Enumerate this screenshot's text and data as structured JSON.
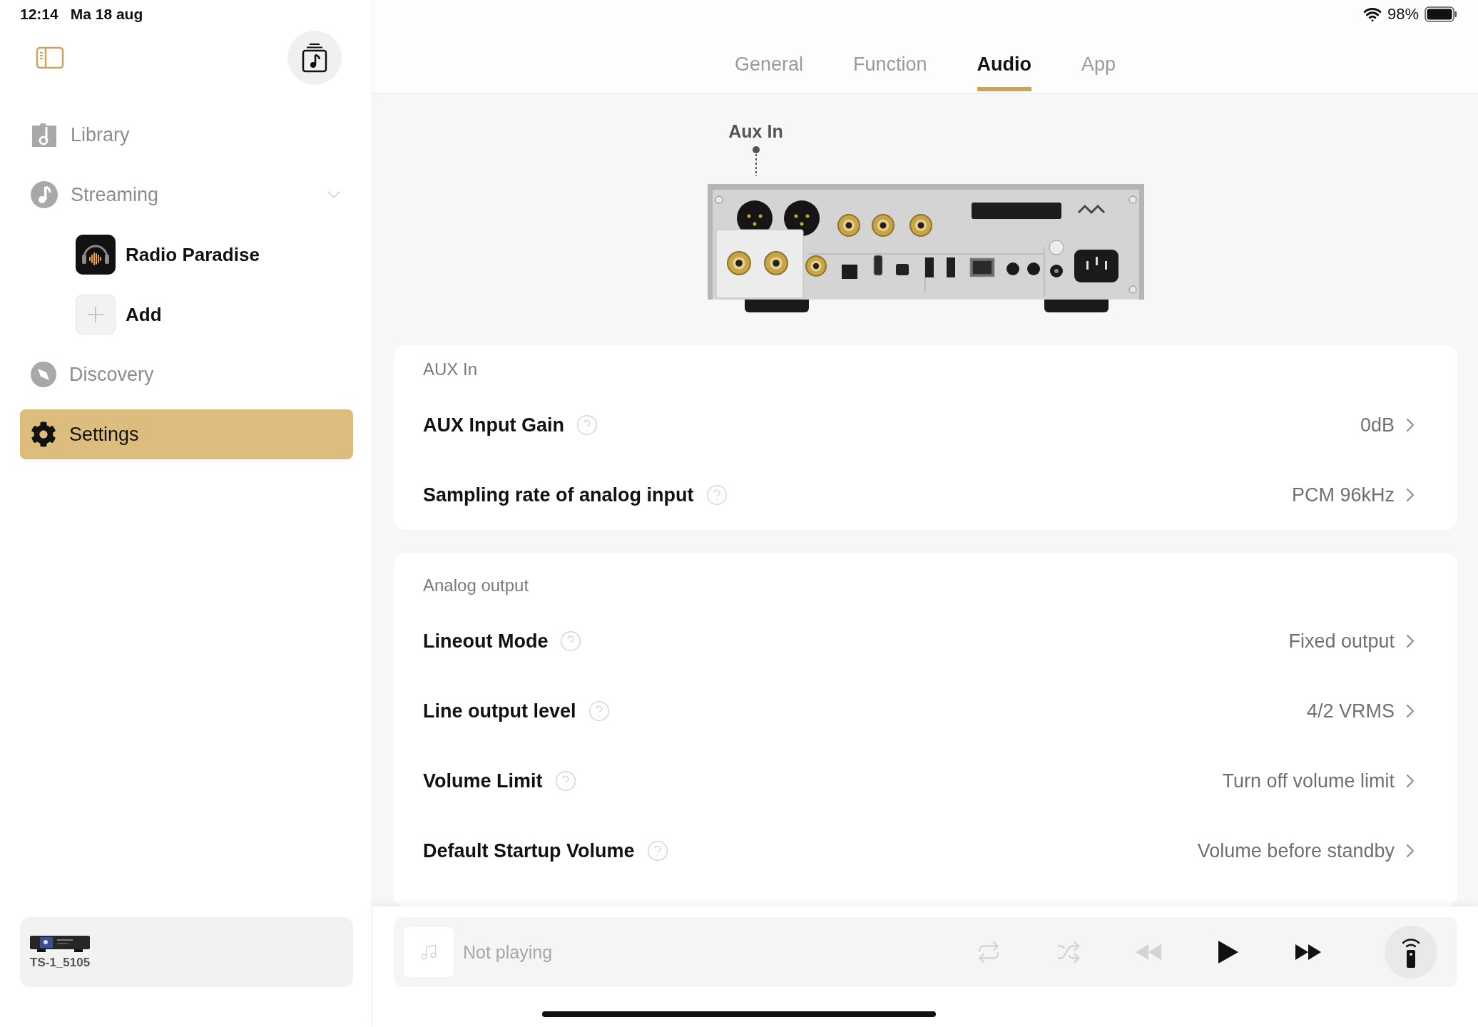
{
  "status_bar": {
    "time": "12:14",
    "date": "Ma 18 aug",
    "battery": "98%"
  },
  "sidebar": {
    "items": [
      {
        "label": "Library",
        "selected": false
      },
      {
        "label": "Streaming",
        "selected": false,
        "expanded": true,
        "children": [
          {
            "kind": "station",
            "label": "Radio Paradise"
          },
          {
            "kind": "add",
            "label": "Add"
          }
        ]
      },
      {
        "label": "Discovery",
        "selected": false
      },
      {
        "label": "Settings",
        "selected": true
      }
    ],
    "device": {
      "name": "TS-1_5105"
    }
  },
  "tabs": [
    {
      "label": "General",
      "selected": false
    },
    {
      "label": "Function",
      "selected": false
    },
    {
      "label": "Audio",
      "selected": true
    },
    {
      "label": "App",
      "selected": false
    }
  ],
  "diagram": {
    "callout": "Aux In"
  },
  "sections": [
    {
      "title": "AUX In",
      "rows": [
        {
          "label": "AUX Input Gain",
          "value": "0dB"
        },
        {
          "label": "Sampling rate of analog input",
          "value": "PCM 96kHz"
        }
      ]
    },
    {
      "title": "Analog output",
      "rows": [
        {
          "label": "Lineout Mode",
          "value": "Fixed output"
        },
        {
          "label": "Line output level",
          "value": "4/2 VRMS"
        },
        {
          "label": "Volume Limit",
          "value": "Turn off volume limit"
        },
        {
          "label": "Default Startup Volume",
          "value": "Volume before standby"
        }
      ]
    }
  ],
  "player": {
    "status": "Not playing",
    "controls": [
      {
        "kind": "repeat",
        "disabled": true
      },
      {
        "kind": "shuffle",
        "disabled": true
      },
      {
        "kind": "previous",
        "disabled": true
      },
      {
        "kind": "play",
        "disabled": false
      },
      {
        "kind": "next",
        "disabled": false
      }
    ]
  }
}
